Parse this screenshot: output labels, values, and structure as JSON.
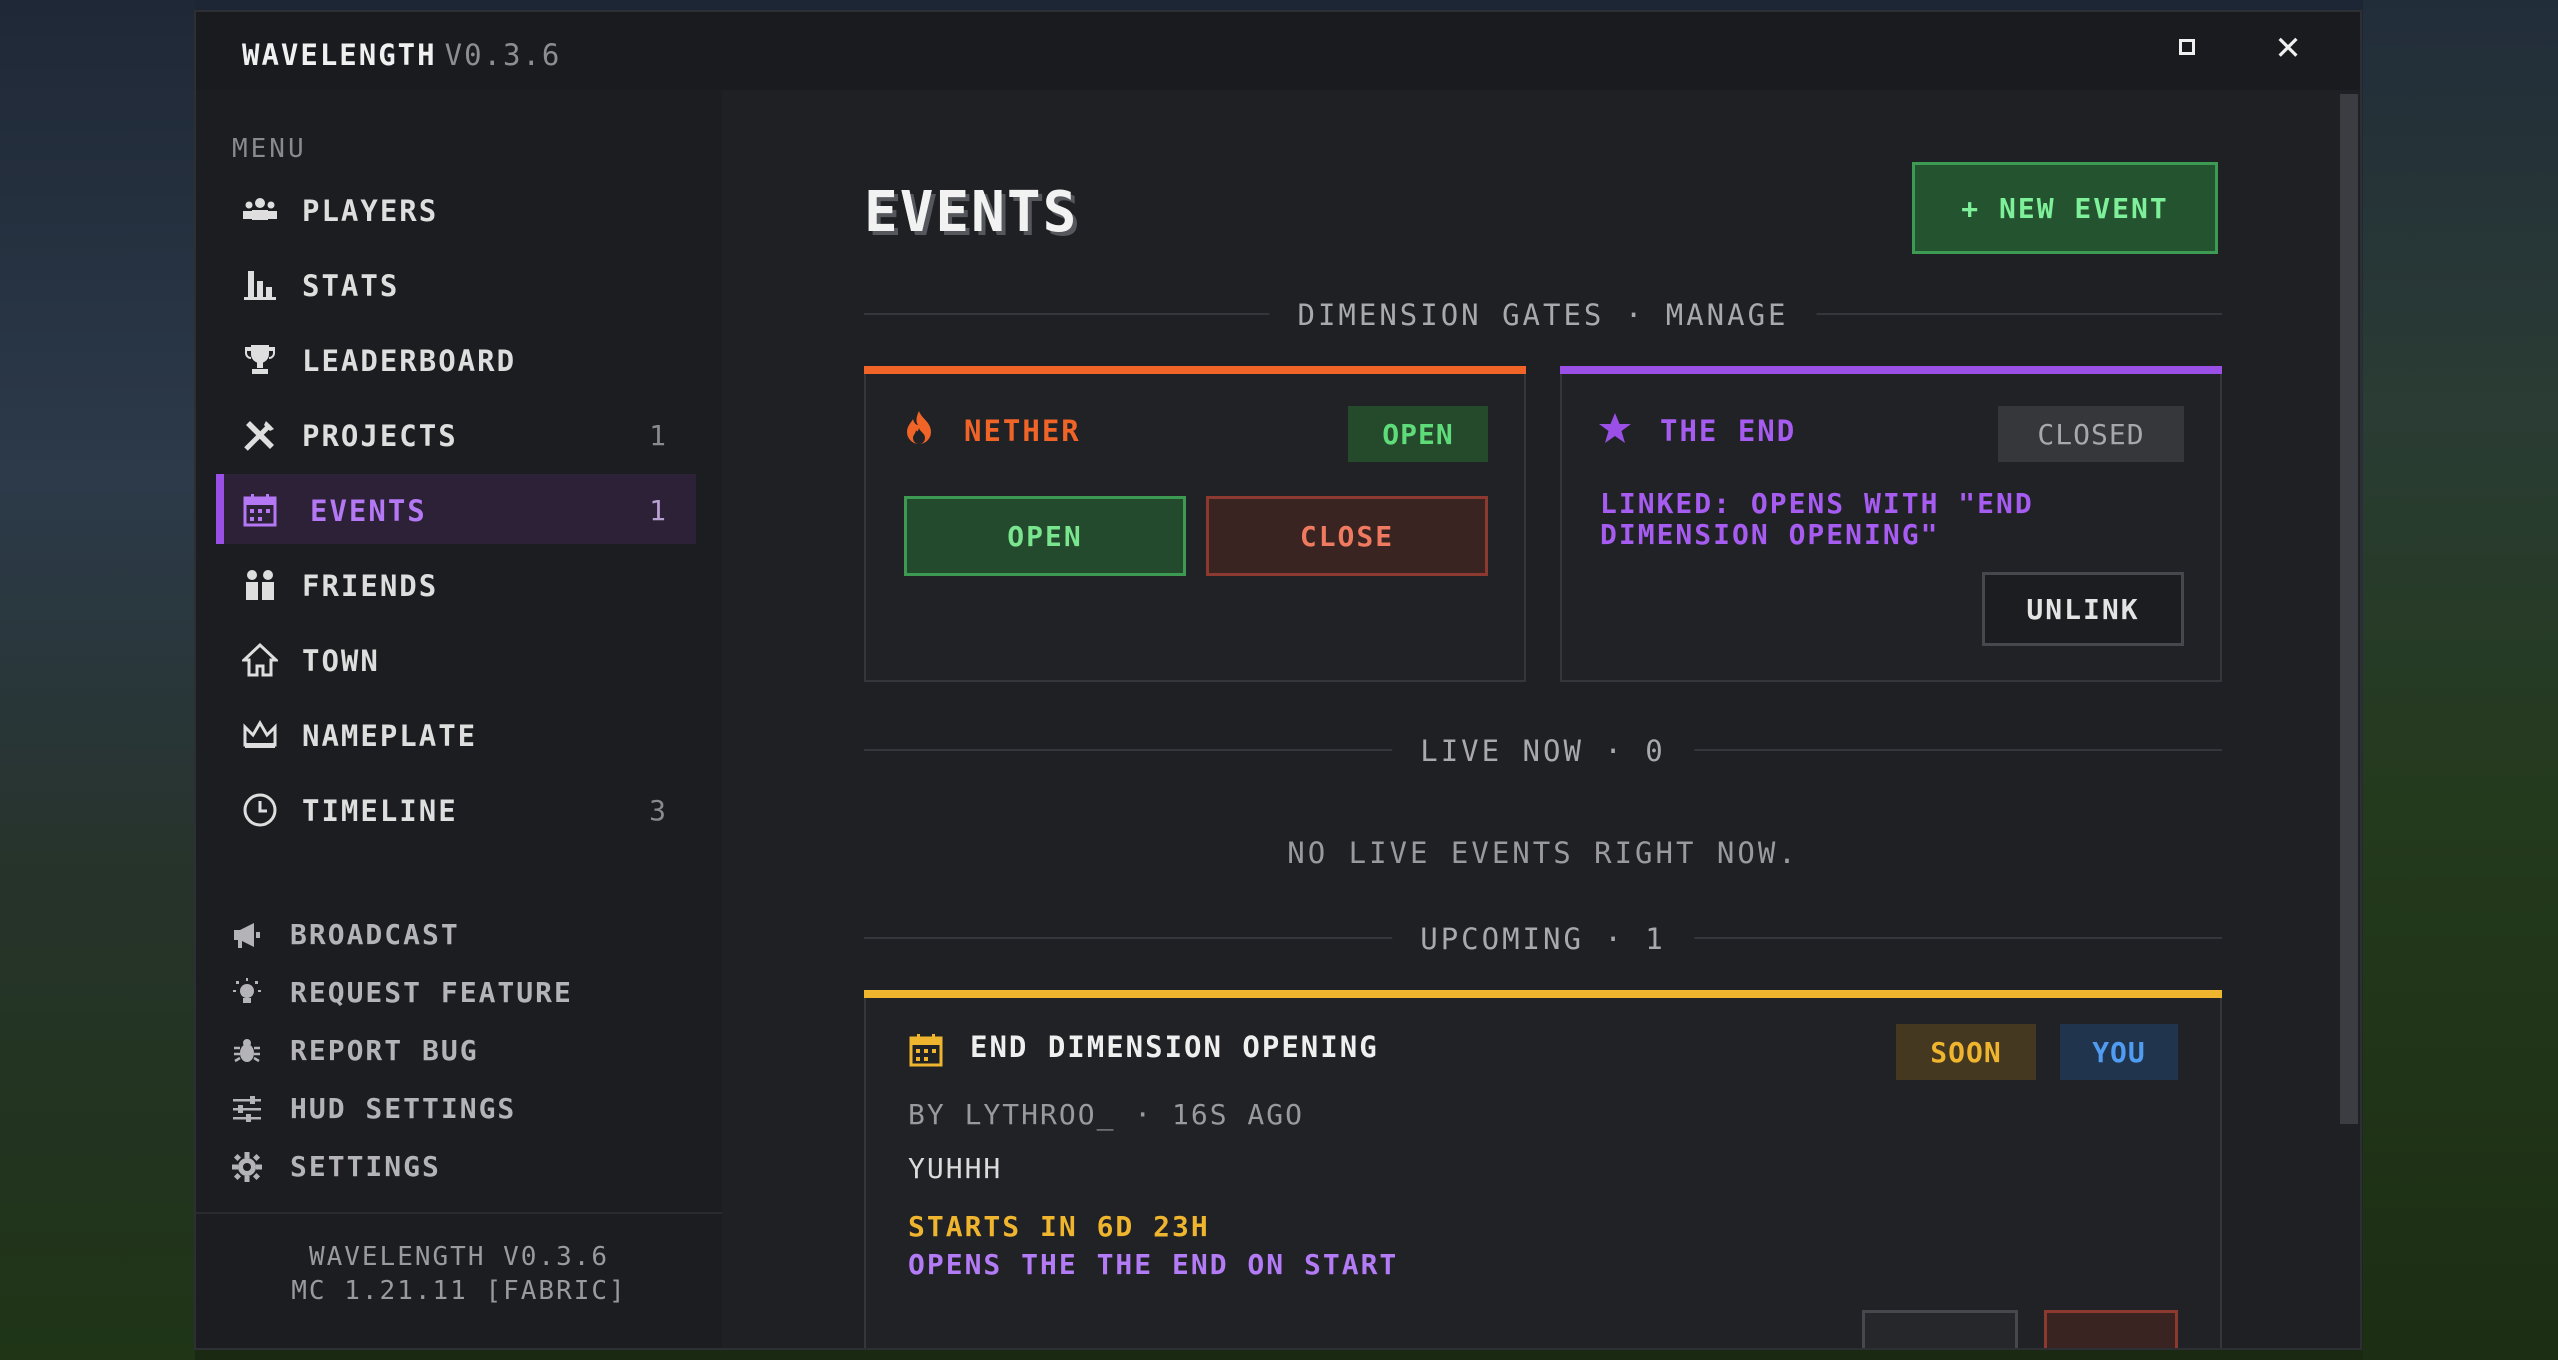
{
  "window": {
    "title": "WAVELENGTH",
    "version": "V0.3.6"
  },
  "sidebar": {
    "menu_label": "MENU",
    "items": [
      {
        "label": "PLAYERS",
        "count": "",
        "icon": "users-icon"
      },
      {
        "label": "STATS",
        "count": "",
        "icon": "bar-chart-icon"
      },
      {
        "label": "LEADERBOARD",
        "count": "",
        "icon": "trophy-icon"
      },
      {
        "label": "PROJECTS",
        "count": "1",
        "icon": "tools-icon"
      },
      {
        "label": "EVENTS",
        "count": "1",
        "icon": "calendar-icon",
        "active": true
      },
      {
        "label": "FRIENDS",
        "count": "",
        "icon": "friends-icon"
      },
      {
        "label": "TOWN",
        "count": "",
        "icon": "house-icon"
      },
      {
        "label": "NAMEPLATE",
        "count": "",
        "icon": "crown-icon"
      },
      {
        "label": "TIMELINE",
        "count": "3",
        "icon": "clock-icon"
      }
    ],
    "utility": [
      {
        "label": "BROADCAST",
        "icon": "megaphone-icon"
      },
      {
        "label": "REQUEST FEATURE",
        "icon": "lightbulb-icon"
      },
      {
        "label": "REPORT BUG",
        "icon": "bug-icon"
      },
      {
        "label": "HUD SETTINGS",
        "icon": "sliders-icon"
      },
      {
        "label": "SETTINGS",
        "icon": "gear-icon"
      }
    ],
    "footer": {
      "line1": "WAVELENGTH V0.3.6",
      "line2": "MC 1.21.11 [FABRIC]"
    }
  },
  "main": {
    "page_title": "EVENTS",
    "new_event_label": "+ NEW EVENT",
    "sections": {
      "gates": "DIMENSION GATES · MANAGE",
      "live": "LIVE NOW · 0",
      "upcoming": "UPCOMING · 1"
    },
    "gates": {
      "nether": {
        "name": "NETHER",
        "status": "OPEN",
        "open_label": "OPEN",
        "close_label": "CLOSE",
        "accent": "#f06428"
      },
      "end": {
        "name": "THE END",
        "status": "CLOSED",
        "linked_text": "LINKED: OPENS WITH \"END DIMENSION OPENING\"",
        "unlink_label": "UNLINK",
        "accent": "#9a4fe6"
      }
    },
    "live_empty": "NO LIVE EVENTS RIGHT NOW.",
    "upcoming": [
      {
        "title": "END DIMENSION OPENING",
        "badges": [
          "SOON",
          "YOU"
        ],
        "meta": "BY LYTHROO_ · 16S AGO",
        "description": "YUHHH",
        "starts": "STARTS IN 6D 23H",
        "opens": "OPENS THE THE END ON START",
        "accent": "#f0b52e"
      }
    ]
  }
}
